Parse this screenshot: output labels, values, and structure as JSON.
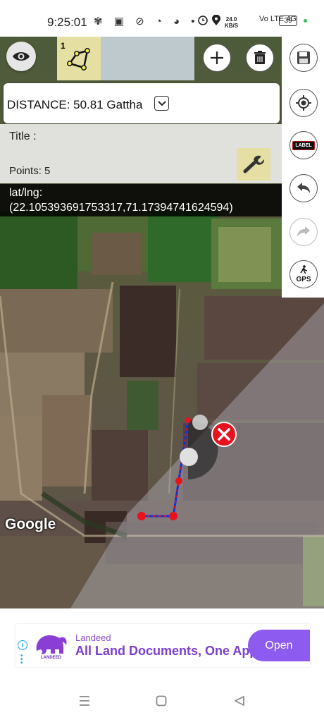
{
  "status_bar": {
    "time": "9:25:01",
    "left_icons": "✾ ▣ ⊘ ◔ ◕ •",
    "net_speed": "24.0",
    "net_unit": "KB/S",
    "signal": "Vo LTE 4G",
    "battery": "39"
  },
  "toolbar": {
    "shape_count": "1"
  },
  "distance": {
    "text": "DISTANCE: 50.81 Gattha"
  },
  "info": {
    "title_label": "Title :",
    "points_label": "Points: 5"
  },
  "latlng": {
    "label": "lat/lng:",
    "value": "(22.105393691753317,71.17394741624594)"
  },
  "map": {
    "attribution": "Google"
  },
  "right_tools": {
    "label_text": "LABEL",
    "gps_text": "GPS"
  },
  "ad": {
    "brand": "Landeed",
    "brand_small": "LANDEED",
    "headline": "All Land Documents, One App",
    "cta": "Open"
  },
  "colors": {
    "accent_yellow": "#e6dfa4",
    "path_blue": "#1a2fd6",
    "point_red": "#e8111e",
    "ad_purple": "#8e5bf0"
  }
}
